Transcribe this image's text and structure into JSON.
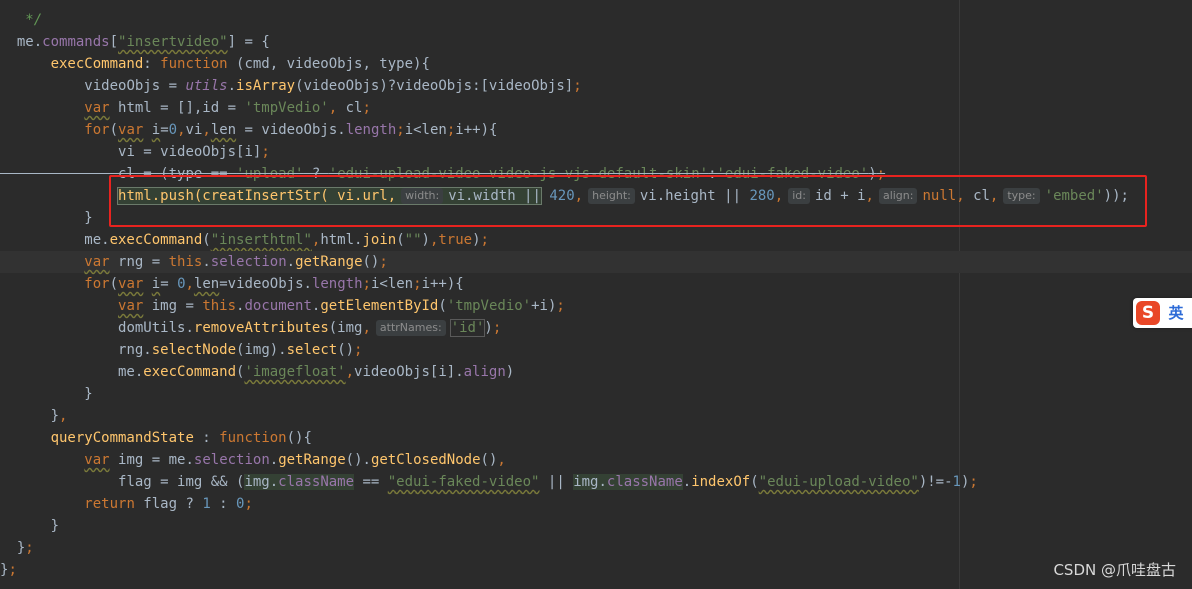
{
  "editor": {
    "lines": [
      "   */",
      "  me.commands[\"insertvideo\"] = {",
      "      execCommand: function (cmd, videoObjs, type){",
      "          videoObjs = utils.isArray(videoObjs)?videoObjs:[videoObjs];",
      "          var html = [],id = 'tmpVedio', cl;",
      "          for(var i=0,vi,len = videoObjs.length;i<len;i++){",
      "              vi = videoObjs[i];",
      "              cl = (type == 'upload' ? 'edui-upload-video video-js vjs-default-skin':'edui-faked-video');",
      "              html.push(creatInsertStr( vi.url,  width: vi.width || 420,  height: vi.height || 280,  id: id + i,  align: null, cl,  type: 'embed'));",
      "          }",
      "          me.execCommand(\"inserthtml\",html.join(\"\"),true);",
      "          var rng = this.selection.getRange();",
      "          for(var i= 0,len=videoObjs.length;i<len;i++){",
      "              var img = this.document.getElementById('tmpVedio'+i);",
      "              domUtils.removeAttributes(img, attrNames: 'id');",
      "              rng.selectNode(img).select();",
      "              me.execCommand('imagefloat',videoObjs[i].align)",
      "          }",
      "      },",
      "      queryCommandState : function(){",
      "          var img = me.selection.getRange().getClosedNode(),",
      "              flag = img && (img.className == \"edui-faked-video\" || img.className.indexOf(\"edui-upload-video\")!=-1);",
      "          return flag ? 1 : 0;",
      "      }",
      "  };",
      "};"
    ],
    "tokens": {
      "comment_end": "*/",
      "me": "me",
      "commands": "commands",
      "str_insertvideo": "\"insertvideo\"",
      "execCommand": "execCommand",
      "function": "function",
      "params1": " (cmd, videoObjs, type){",
      "videoObjs": "videoObjs",
      "utils": "utils",
      "isArray": "isArray",
      "isArray_rest": "(videoObjs)?videoObjs:[videoObjs]",
      "var": "var",
      "html_decl": " html = [],id = ",
      "str_tmpVedio": "'tmpVedio'",
      "cl_decl": " cl",
      "for": "for",
      "i": "i",
      "num0": "0",
      "vi": "vi",
      "len": "len",
      "length": "length",
      "loop_rest": "i<len",
      "loop_inc": "i++){",
      "vi_assign": "vi = videoObjs[i]",
      "cl_assign": "cl = (type == ",
      "str_upload": "'upload'",
      "str_upload_cls": "'edui-upload-video video-js vjs-default-skin'",
      "str_faked_cls": "'edui-faked-video'",
      "push_call": "html.push(creatInsertStr( vi.url,",
      "hint_width": "width:",
      "vi_width": "vi.width ||",
      "num420": "420",
      "hint_height": "height:",
      "vi_height": "vi.height || ",
      "num280": "280",
      "hint_id": "id:",
      "id_plus": "id + i",
      "hint_align": "align:",
      "null": "null",
      "cl": "cl",
      "hint_type": "type:",
      "str_embed": "'embed'",
      "close_push": "));",
      "str_inserthtml": "\"inserthtml\"",
      "html_join": "html.",
      "join": "join",
      "str_empty": "\"\"",
      "true": "true",
      "rng": " rng = ",
      "this": "this",
      "selection": "selection",
      "getRange": "getRange",
      "num0b": " 0",
      "img": " img = ",
      "document": "document",
      "getElementById": "getElementById",
      "domUtils": "domUtils",
      "removeAttributes": "removeAttributes",
      "hint_attrNames": "attrNames:",
      "str_id": "'id'",
      "rng_select": "rng.",
      "selectNode": "selectNode",
      "select": "select",
      "str_imagefloat": "'imagefloat'",
      "align": "align",
      "queryCommandState": "queryCommandState",
      "getClosedNode": "getClosedNode",
      "flag": "flag = img && (",
      "img_cls": "img.",
      "className": "className",
      "str_faked_dq": "\"edui-faked-video\"",
      "indexOf": "indexOf",
      "str_upload_dq": "\"edui-upload-video\"",
      "num_neg1": "1",
      "return": "return",
      "return_rest": " flag ? ",
      "num1": "1",
      "num0c": "0"
    }
  },
  "ime": {
    "logo_glyph": "S",
    "mode_label": "英"
  },
  "watermark": "CSDN @爪哇盘古",
  "colors": {
    "background": "#2b2b2b",
    "keyword": "#cc7832",
    "string": "#6a8759",
    "number": "#6897bb",
    "function": "#ffc66d",
    "property": "#9876aa",
    "highlight_box": "#e8231f"
  }
}
